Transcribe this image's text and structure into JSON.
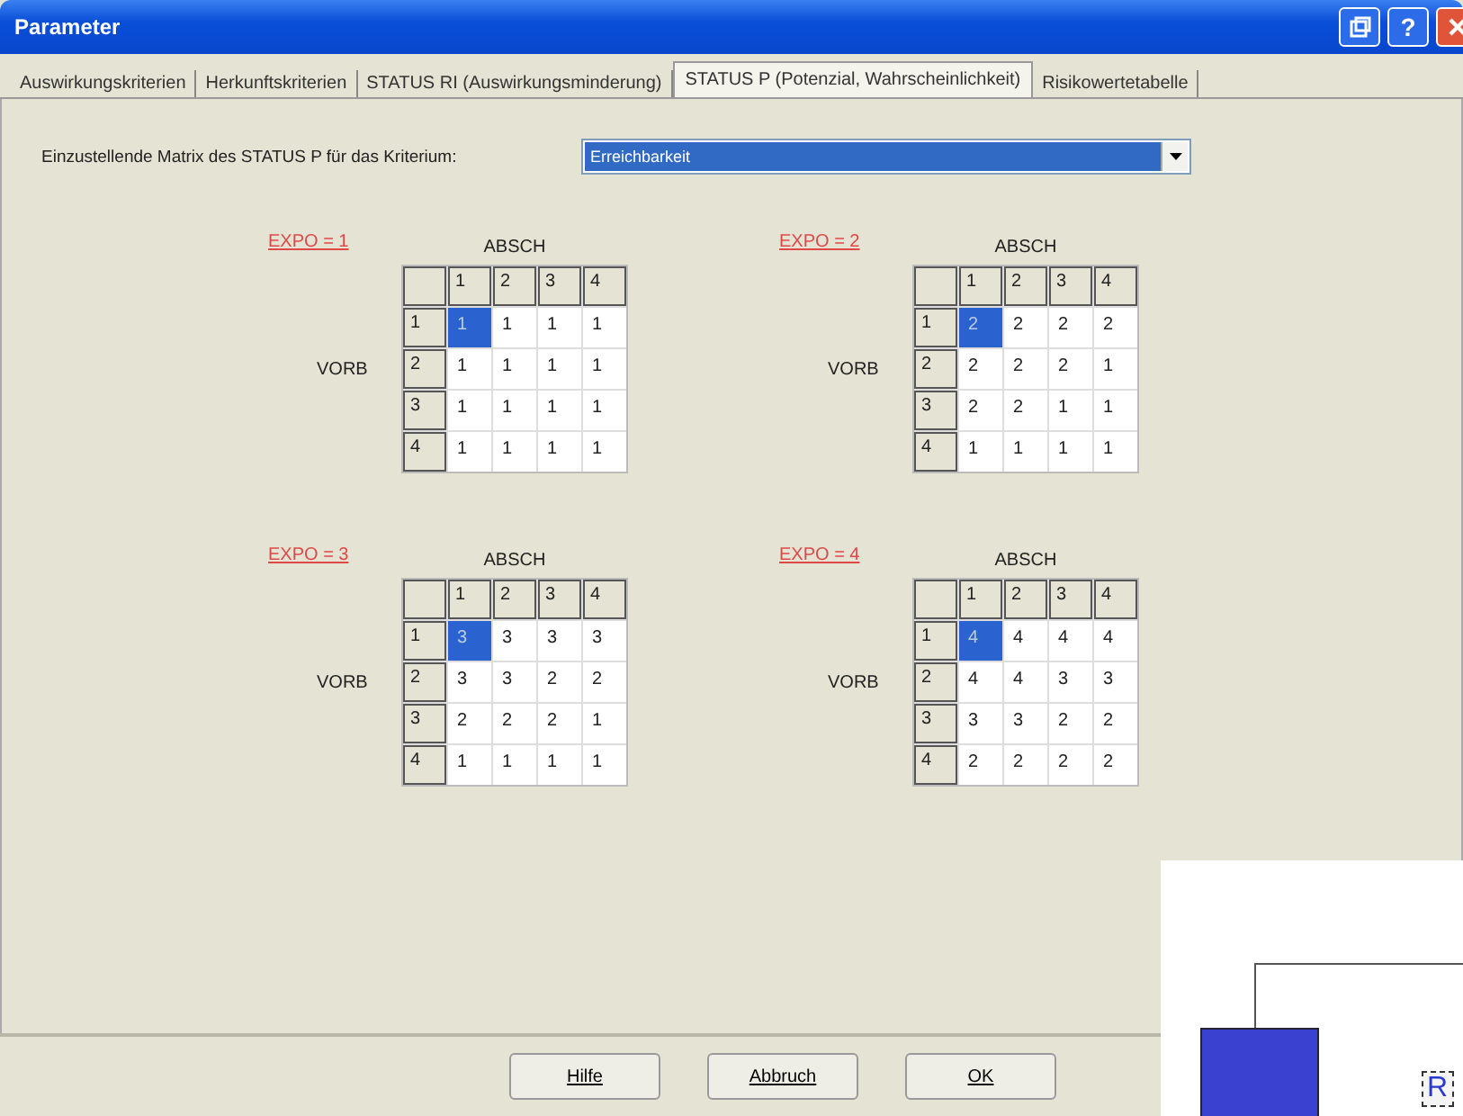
{
  "window": {
    "title": "Parameter"
  },
  "title_buttons": [
    {
      "kind": "restore"
    },
    {
      "kind": "help",
      "label": "?"
    },
    {
      "kind": "close"
    }
  ],
  "tabs": [
    {
      "label": "Auswirkungskriterien",
      "selected": false
    },
    {
      "label": "Herkunftskriterien",
      "selected": false
    },
    {
      "label": "STATUS RI (Auswirkungsminderung)",
      "selected": false
    },
    {
      "label": "STATUS P (Potenzial, Wahrscheinlichkeit)",
      "selected": true
    },
    {
      "label": "Risikowertetabelle",
      "selected": false
    }
  ],
  "criterion": {
    "label": "Einzustellende Matrix des STATUS P für das Kriterium:",
    "value": "Erreichbarkeit"
  },
  "matrices": [
    {
      "title": "EXPO = 1",
      "col_axis": "ABSCH",
      "row_axis": "VORB",
      "columns": [
        "1",
        "2",
        "3",
        "4"
      ],
      "rows": [
        {
          "label": "1",
          "cells": [
            {
              "value": "1",
              "selected": true
            },
            {
              "value": "1",
              "selected": false
            },
            {
              "value": "1",
              "selected": false
            },
            {
              "value": "1",
              "selected": false
            }
          ]
        },
        {
          "label": "2",
          "cells": [
            {
              "value": "1",
              "selected": false
            },
            {
              "value": "1",
              "selected": false
            },
            {
              "value": "1",
              "selected": false
            },
            {
              "value": "1",
              "selected": false
            }
          ]
        },
        {
          "label": "3",
          "cells": [
            {
              "value": "1",
              "selected": false
            },
            {
              "value": "1",
              "selected": false
            },
            {
              "value": "1",
              "selected": false
            },
            {
              "value": "1",
              "selected": false
            }
          ]
        },
        {
          "label": "4",
          "cells": [
            {
              "value": "1",
              "selected": false
            },
            {
              "value": "1",
              "selected": false
            },
            {
              "value": "1",
              "selected": false
            },
            {
              "value": "1",
              "selected": false
            }
          ]
        }
      ]
    },
    {
      "title": "EXPO = 2",
      "col_axis": "ABSCH",
      "row_axis": "VORB",
      "columns": [
        "1",
        "2",
        "3",
        "4"
      ],
      "rows": [
        {
          "label": "1",
          "cells": [
            {
              "value": "2",
              "selected": true
            },
            {
              "value": "2",
              "selected": false
            },
            {
              "value": "2",
              "selected": false
            },
            {
              "value": "2",
              "selected": false
            }
          ]
        },
        {
          "label": "2",
          "cells": [
            {
              "value": "2",
              "selected": false
            },
            {
              "value": "2",
              "selected": false
            },
            {
              "value": "2",
              "selected": false
            },
            {
              "value": "1",
              "selected": false
            }
          ]
        },
        {
          "label": "3",
          "cells": [
            {
              "value": "2",
              "selected": false
            },
            {
              "value": "2",
              "selected": false
            },
            {
              "value": "1",
              "selected": false
            },
            {
              "value": "1",
              "selected": false
            }
          ]
        },
        {
          "label": "4",
          "cells": [
            {
              "value": "1",
              "selected": false
            },
            {
              "value": "1",
              "selected": false
            },
            {
              "value": "1",
              "selected": false
            },
            {
              "value": "1",
              "selected": false
            }
          ]
        }
      ]
    },
    {
      "title": "EXPO = 3",
      "col_axis": "ABSCH",
      "row_axis": "VORB",
      "columns": [
        "1",
        "2",
        "3",
        "4"
      ],
      "rows": [
        {
          "label": "1",
          "cells": [
            {
              "value": "3",
              "selected": true
            },
            {
              "value": "3",
              "selected": false
            },
            {
              "value": "3",
              "selected": false
            },
            {
              "value": "3",
              "selected": false
            }
          ]
        },
        {
          "label": "2",
          "cells": [
            {
              "value": "3",
              "selected": false
            },
            {
              "value": "3",
              "selected": false
            },
            {
              "value": "2",
              "selected": false
            },
            {
              "value": "2",
              "selected": false
            }
          ]
        },
        {
          "label": "3",
          "cells": [
            {
              "value": "2",
              "selected": false
            },
            {
              "value": "2",
              "selected": false
            },
            {
              "value": "2",
              "selected": false
            },
            {
              "value": "1",
              "selected": false
            }
          ]
        },
        {
          "label": "4",
          "cells": [
            {
              "value": "1",
              "selected": false
            },
            {
              "value": "1",
              "selected": false
            },
            {
              "value": "1",
              "selected": false
            },
            {
              "value": "1",
              "selected": false
            }
          ]
        }
      ]
    },
    {
      "title": "EXPO = 4",
      "col_axis": "ABSCH",
      "row_axis": "VORB",
      "columns": [
        "1",
        "2",
        "3",
        "4"
      ],
      "rows": [
        {
          "label": "1",
          "cells": [
            {
              "value": "4",
              "selected": true
            },
            {
              "value": "4",
              "selected": false
            },
            {
              "value": "4",
              "selected": false
            },
            {
              "value": "4",
              "selected": false
            }
          ]
        },
        {
          "label": "2",
          "cells": [
            {
              "value": "4",
              "selected": false
            },
            {
              "value": "4",
              "selected": false
            },
            {
              "value": "3",
              "selected": false
            },
            {
              "value": "3",
              "selected": false
            }
          ]
        },
        {
          "label": "3",
          "cells": [
            {
              "value": "3",
              "selected": false
            },
            {
              "value": "3",
              "selected": false
            },
            {
              "value": "2",
              "selected": false
            },
            {
              "value": "2",
              "selected": false
            }
          ]
        },
        {
          "label": "4",
          "cells": [
            {
              "value": "2",
              "selected": false
            },
            {
              "value": "2",
              "selected": false
            },
            {
              "value": "2",
              "selected": false
            },
            {
              "value": "2",
              "selected": false
            }
          ]
        }
      ]
    }
  ],
  "buttons": [
    {
      "label": "Hilfe"
    },
    {
      "label": "Abbruch"
    },
    {
      "label": "OK"
    }
  ],
  "overlay_window": {
    "label": "R"
  }
}
